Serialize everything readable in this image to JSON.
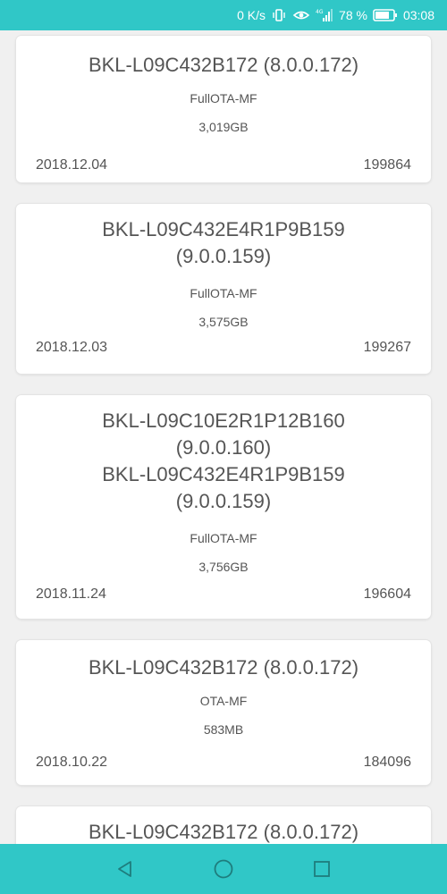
{
  "status_bar": {
    "network_speed": "0 K/s",
    "battery_percent": "78 %",
    "time": "03:08"
  },
  "cards": [
    {
      "title": "BKL-L09C432B172 (8.0.0.172)",
      "type": "FullOTA-MF",
      "size": "3,019GB",
      "date": "2018.12.04",
      "id": "199864"
    },
    {
      "title_lines": [
        "BKL-L09C432E4R1P9B159",
        "(9.0.0.159)"
      ],
      "type": "FullOTA-MF",
      "size": "3,575GB",
      "date": "2018.12.03",
      "id": "199267"
    },
    {
      "title_lines": [
        "BKL-L09C10E2R1P12B160",
        "(9.0.0.160)",
        "BKL-L09C432E4R1P9B159",
        "(9.0.0.159)"
      ],
      "type": "FullOTA-MF",
      "size": "3,756GB",
      "date": "2018.11.24",
      "id": "196604"
    },
    {
      "title": "BKL-L09C432B172 (8.0.0.172)",
      "type": "OTA-MF",
      "size": "583MB",
      "date": "2018.10.22",
      "id": "184096"
    },
    {
      "title": "BKL-L09C432B172 (8.0.0.172)"
    }
  ],
  "colors": {
    "accent": "#30c7c7",
    "background": "#f0f0f0",
    "card": "#ffffff",
    "text": "#555555"
  }
}
